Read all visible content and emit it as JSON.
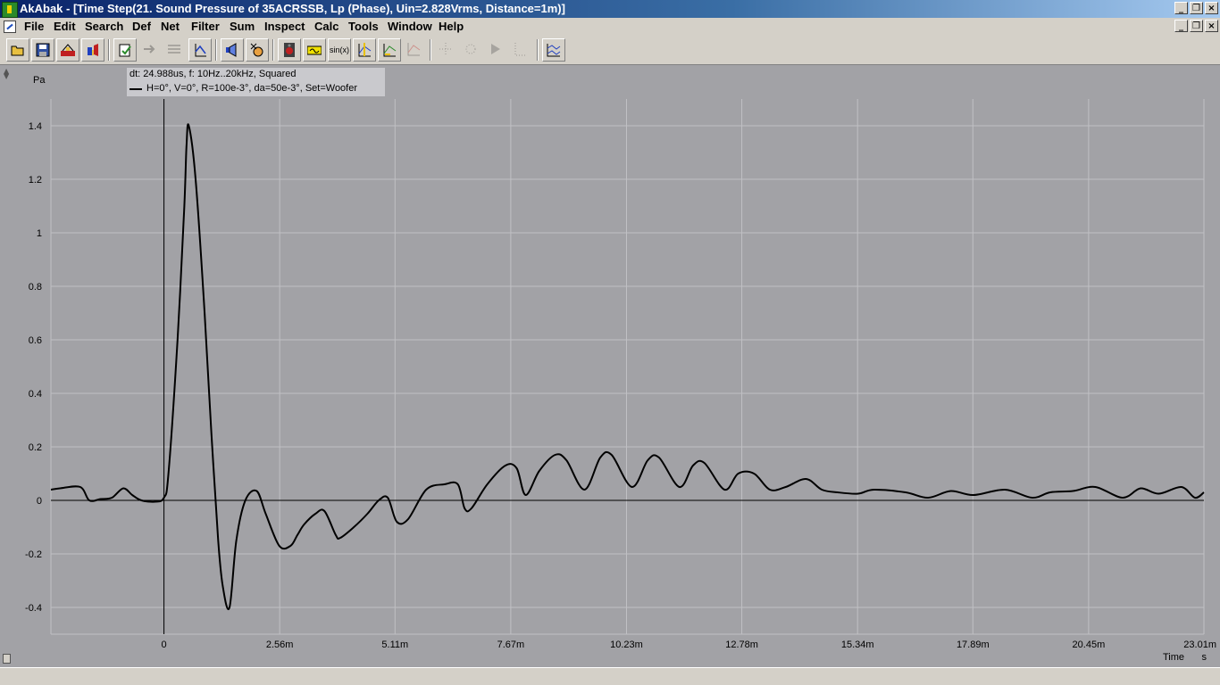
{
  "window": {
    "title": "AkAbak - [Time Step(21. Sound Pressure of 35ACRSSB, Lp (Phase), Uin=2.828Vrms, Distance=1m)]",
    "buttons": {
      "minimize": "_",
      "restore": "❐",
      "close": "×"
    }
  },
  "menu": [
    "File",
    "Edit",
    "Search",
    "Def",
    "Net",
    "Filter",
    "Sum",
    "Inspect",
    "Calc",
    "Tools",
    "Window",
    "Help"
  ],
  "toolbar": {
    "icons": [
      "open-folder-icon",
      "save-icon",
      "net-icon",
      "driver-icon",
      "clipboard-icon",
      "arrow-icon",
      "grid-icon",
      "axis-icon",
      "speaker-icon",
      "speaker-cross-icon",
      "loudspeaker-icon",
      "filter-icon",
      "sinx-icon",
      "plot-cursor-icon",
      "plot-cursor-2-icon",
      "plot-cursor-3-icon",
      "dotted-grid-icon",
      "dotted-grid-2-icon",
      "dotted-grid-3-icon",
      "dotted-grid-4-icon",
      "chart-layout-icon"
    ],
    "sinx_label": "sin(x)"
  },
  "legend": {
    "line1": "dt: 24.988us, f: 10Hz..20kHz, Squared",
    "line2": "H=0°, V=0°, R=100e-3°, da=50e-3°, Set=Woofer"
  },
  "colors": {
    "plot_bg": "#a2a2a6",
    "grid": "#c0c0c4",
    "trace": "#000000",
    "ui": "#d4d0c8"
  },
  "chart_data": {
    "type": "line",
    "ylabel": "Pa",
    "xlabel": "Time",
    "xunit": "s",
    "xlim": [
      -0.0025,
      0.023
    ],
    "ylim": [
      -0.5,
      1.5
    ],
    "xticks": [
      0,
      0.00256,
      0.00511,
      0.00767,
      0.01023,
      0.01278,
      0.01534,
      0.01789,
      0.02045,
      0.023
    ],
    "xtick_labels": [
      "0",
      "2.56m",
      "5.11m",
      "7.67m",
      "10.23m",
      "12.78m",
      "15.34m",
      "17.89m",
      "20.45m",
      "23.01m"
    ],
    "yticks": [
      -0.4,
      -0.2,
      0,
      0.2,
      0.4,
      0.6,
      0.8,
      1,
      1.2,
      1.4
    ],
    "ytick_labels": [
      "-0.4",
      "-0.2",
      "0",
      "0.2",
      "0.4",
      "0.6",
      "0.8",
      "1",
      "1.2",
      "1.4"
    ],
    "grid": true,
    "series": [
      {
        "name": "H=0°, V=0°, R=100e-3°, da=50e-3°, Set=Woofer",
        "x": [
          -0.0025,
          -0.0023,
          -0.00185,
          -0.00165,
          -0.0014,
          -0.00115,
          -0.0009,
          -0.0007,
          -0.0005,
          -0.0002,
          0,
          0.0001,
          0.0003,
          0.00045,
          0.0005,
          0.00055,
          0.0007,
          0.0009,
          0.00105,
          0.0012,
          0.0013,
          0.00145,
          0.0016,
          0.0018,
          0.00205,
          0.00225,
          0.00255,
          0.0028,
          0.00295,
          0.0031,
          0.00335,
          0.00355,
          0.0038,
          0.0039,
          0.0042,
          0.0045,
          0.00475,
          0.00495,
          0.00515,
          0.0054,
          0.0058,
          0.0062,
          0.0065,
          0.00665,
          0.0068,
          0.00715,
          0.00755,
          0.0078,
          0.008,
          0.0083,
          0.00865,
          0.0089,
          0.0093,
          0.00965,
          0.0099,
          0.01035,
          0.0107,
          0.01095,
          0.0114,
          0.0117,
          0.01195,
          0.0124,
          0.0127,
          0.01305,
          0.0134,
          0.01375,
          0.0142,
          0.01455,
          0.0149,
          0.01535,
          0.0157,
          0.0164,
          0.0169,
          0.0174,
          0.0179,
          0.0186,
          0.0192,
          0.0196,
          0.0201,
          0.0206,
          0.0212,
          0.0216,
          0.022,
          0.0225,
          0.0228,
          0.023
        ],
        "y": [
          0.04,
          0.045,
          0.05,
          0.0,
          0.005,
          0.01,
          0.045,
          0.02,
          0.0,
          -0.005,
          0.01,
          0.1,
          0.6,
          1.1,
          1.33,
          1.4,
          1.2,
          0.7,
          0.25,
          -0.15,
          -0.32,
          -0.4,
          -0.15,
          0.0,
          0.035,
          -0.05,
          -0.17,
          -0.17,
          -0.13,
          -0.09,
          -0.05,
          -0.04,
          -0.13,
          -0.14,
          -0.1,
          -0.05,
          0.0,
          0.01,
          -0.08,
          -0.07,
          0.04,
          0.06,
          0.06,
          -0.03,
          -0.03,
          0.06,
          0.13,
          0.12,
          0.02,
          0.11,
          0.17,
          0.15,
          0.04,
          0.16,
          0.17,
          0.05,
          0.15,
          0.16,
          0.05,
          0.13,
          0.14,
          0.04,
          0.1,
          0.1,
          0.04,
          0.05,
          0.08,
          0.04,
          0.03,
          0.025,
          0.04,
          0.03,
          0.01,
          0.035,
          0.02,
          0.04,
          0.01,
          0.03,
          0.035,
          0.05,
          0.01,
          0.045,
          0.025,
          0.05,
          0.01,
          0.03
        ]
      }
    ]
  }
}
